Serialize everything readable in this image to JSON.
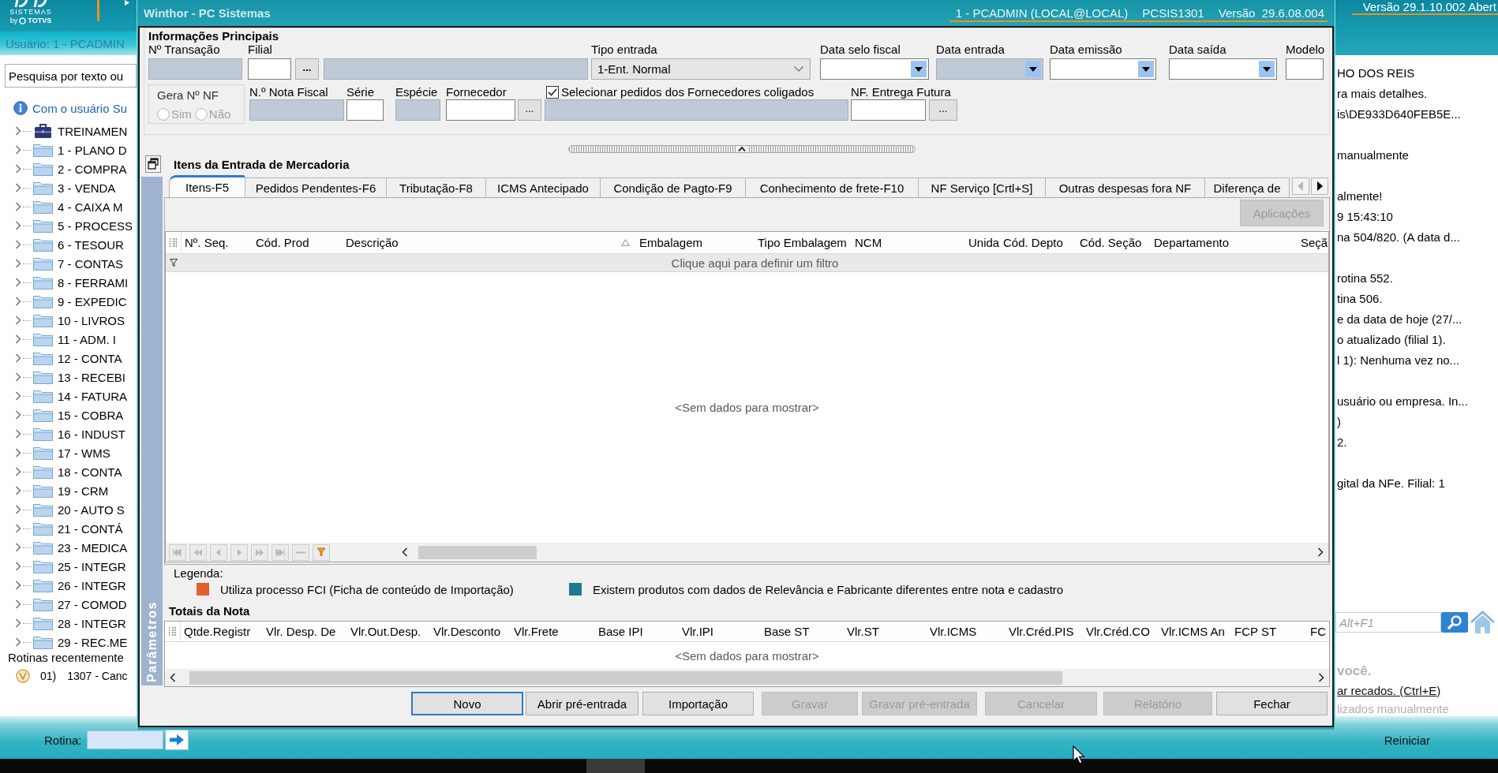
{
  "app": {
    "logo": {
      "name": "SISTEMAS",
      "by": "by",
      "brand": "TOTVS"
    },
    "version": "Versão 29.1.10.002 Abert",
    "user": "Usuário: 1 - PCADMIN",
    "search": {
      "placeholder": "Pesquisa por texto ou"
    },
    "notice": "Com o usuário Su",
    "menu": [
      {
        "label": "TREINAMEN",
        "kind": "briefcase",
        "expanded": false
      },
      {
        "label": "1 - PLANO D",
        "kind": "folder",
        "expanded": false
      },
      {
        "label": "2 - COMPRA",
        "kind": "folder",
        "expanded": false
      },
      {
        "label": "3 - VENDA",
        "kind": "folder",
        "expanded": false
      },
      {
        "label": "4 - CAIXA M",
        "kind": "folder",
        "expanded": false
      },
      {
        "label": "5 - PROCESS",
        "kind": "folder",
        "expanded": false
      },
      {
        "label": "6 - TESOUR",
        "kind": "folder",
        "expanded": false
      },
      {
        "label": "7 - CONTAS",
        "kind": "folder",
        "expanded": false
      },
      {
        "label": "8 - FERRAMI",
        "kind": "folder",
        "expanded": false
      },
      {
        "label": "9 - EXPEDIC",
        "kind": "folder",
        "expanded": false
      },
      {
        "label": "10 - LIVROS",
        "kind": "folder",
        "expanded": false
      },
      {
        "label": "11 - ADM. I",
        "kind": "folder",
        "expanded": false
      },
      {
        "label": "12 - CONTA",
        "kind": "folder",
        "expanded": false
      },
      {
        "label": "13 - RECEBI",
        "kind": "folder",
        "expanded": false
      },
      {
        "label": "14 - FATURA",
        "kind": "folder",
        "expanded": false
      },
      {
        "label": "15 - COBRA",
        "kind": "folder",
        "expanded": false
      },
      {
        "label": "16 - INDUST",
        "kind": "folder",
        "expanded": false
      },
      {
        "label": "17 - WMS",
        "kind": "folder",
        "expanded": false
      },
      {
        "label": "18 - CONTA",
        "kind": "folder",
        "expanded": false
      },
      {
        "label": "19 - CRM",
        "kind": "folder",
        "expanded": false
      },
      {
        "label": "20 - AUTO S",
        "kind": "folder",
        "expanded": false
      },
      {
        "label": "21 - CONTÁ",
        "kind": "folder",
        "expanded": false
      },
      {
        "label": "23 - MEDICA",
        "kind": "folder",
        "expanded": false
      },
      {
        "label": "25 - INTEGR",
        "kind": "folder",
        "expanded": false
      },
      {
        "label": "26 - INTEGR",
        "kind": "folder",
        "expanded": false
      },
      {
        "label": "27 - COMOD",
        "kind": "folder",
        "expanded": false
      },
      {
        "label": "28 - INTEGR",
        "kind": "folder",
        "expanded": false
      },
      {
        "label": "29 - REC.ME",
        "kind": "folder",
        "expanded": false
      }
    ],
    "recent": {
      "title": "Rotinas recentemente",
      "items": [
        {
          "number": "01)",
          "label": "1307 - Canc"
        }
      ]
    },
    "messages": [
      [
        "HO DOS REIS",
        "ra mais detalhes.",
        "is\\DE933D640FEB5E..."
      ],
      [
        "manualmente"
      ],
      [
        "almente!",
        "9 15:43:10",
        "na 504/820. (A data d..."
      ],
      [
        "rotina 552.",
        "tina 506.",
        "e da data de hoje (27/...",
        "o atualizado (filial 1).",
        "l 1): Nenhuma vez no..."
      ],
      [
        "usuário ou empresa. In...",
        ")",
        "2."
      ],
      [
        "gital da NFe. Filial: 1"
      ]
    ],
    "help_search": {
      "placeholder": "Alt+F1"
    },
    "greeting": "você.",
    "link": "ar recados. (Ctrl+E)",
    "footnote": "lizados manualmente",
    "routine": {
      "label": "Rotina:"
    },
    "restart": "Reiniciar"
  },
  "window": {
    "title": "Winthor - PC Sistemas",
    "session": [
      "1 - PCADMIN (LOCAL@LOCAL)",
      "PCSIS1301",
      "Versão  29.6.08.004"
    ]
  },
  "main_info": {
    "title": "Informações Principais",
    "transaction": {
      "label": "Nº Transação",
      "disabled": true
    },
    "branch": {
      "label": "Filial",
      "disabled": false,
      "button": "...",
      "name_disabled": true
    },
    "entry_type": {
      "label": "Tipo entrada",
      "value": "1-Ent. Normal"
    },
    "dates": [
      {
        "label": "Data selo fiscal",
        "disabled": false
      },
      {
        "label": "Data entrada",
        "disabled": true
      },
      {
        "label": "Data emissão",
        "disabled": false
      },
      {
        "label": "Data saída",
        "disabled": false
      }
    ],
    "model": {
      "label": "Modelo",
      "disabled": false
    },
    "generate_nf": {
      "title": "Gera Nº NF",
      "disabled": true,
      "options": [
        {
          "label": "Sim",
          "selected": false
        },
        {
          "label": "Não",
          "selected": false
        }
      ]
    },
    "invoice_number": {
      "label": "N.º Nota Fiscal",
      "disabled": true
    },
    "series": {
      "label": "Série",
      "disabled": false
    },
    "species": {
      "label": "Espécie",
      "disabled": true
    },
    "supplier": {
      "label": "Fornecedor",
      "disabled": false,
      "button": "..."
    },
    "linked_suppliers": {
      "label": "Selecionar pedidos dos Fornecedores coligados",
      "checked": true,
      "name_disabled": true
    },
    "future_delivery": {
      "label": "NF. Entrega Futura",
      "disabled": false,
      "button": "..."
    }
  },
  "side_tab": "Parâmetros",
  "items": {
    "title": "Itens da Entrada de Mercadoria",
    "tabs": [
      {
        "label": "Itens-F5",
        "selected": true
      },
      {
        "label": "Pedidos Pendentes-F6",
        "selected": false
      },
      {
        "label": "Tributação-F8",
        "selected": false
      },
      {
        "label": "ICMS Antecipado",
        "selected": false
      },
      {
        "label": "Condição de Pagto-F9",
        "selected": false
      },
      {
        "label": "Conhecimento de frete-F10",
        "selected": false
      },
      {
        "label": "NF Serviço [Crtl+S]",
        "selected": false
      },
      {
        "label": "Outras despesas fora NF",
        "selected": false
      },
      {
        "label": "Diferença de",
        "selected": false
      }
    ],
    "apply": {
      "label": "Aplicações",
      "disabled": true
    },
    "columns": [
      {
        "label": "Nº. Seq.",
        "sorted": false
      },
      {
        "label": "Cód. Prod",
        "sorted": false
      },
      {
        "label": "Descrição",
        "sorted": true
      },
      {
        "label": "Embalagem",
        "sorted": false
      },
      {
        "label": "Tipo Embalagem",
        "sorted": false
      },
      {
        "label": "NCM",
        "sorted": false
      },
      {
        "label": "Unida",
        "sorted": false
      },
      {
        "label": "Cód. Depto",
        "sorted": false
      },
      {
        "label": "Cód. Seção",
        "sorted": false
      },
      {
        "label": "Departamento",
        "sorted": false
      },
      {
        "label": "Seçã",
        "sorted": false
      }
    ],
    "filter_hint": "Clique aqui para definir um filtro",
    "empty": "<Sem dados para mostrar>"
  },
  "legend": {
    "title": "Legenda:",
    "items": [
      {
        "label": "Utiliza processo FCI (Ficha de conteúdo de Importação)",
        "color": "#e0612c"
      },
      {
        "label": "Existem produtos com dados de Relevância e Fabricante diferentes entre nota e cadastro",
        "color": "#1d7a90"
      }
    ]
  },
  "totals": {
    "title": "Totais da Nota",
    "columns": [
      "Qtde.Registr",
      "Vlr. Desp. De",
      "Vlr.Out.Desp.",
      "Vlr.Desconto",
      "Vlr.Frete",
      "Base IPI",
      "Vlr.IPI",
      "Base ST",
      "Vlr.ST",
      "Vlr.ICMS",
      "Vlr.Créd.PIS",
      "Vlr.Créd.CO",
      "Vlr.ICMS An",
      "FCP ST",
      "FC"
    ],
    "empty": "<Sem dados para mostrar>"
  },
  "buttons": [
    {
      "label": "Novo",
      "disabled": false,
      "focused": true
    },
    {
      "label": "Abrir pré-entrada",
      "disabled": false,
      "focused": false
    },
    {
      "label": "Importação",
      "disabled": false,
      "focused": false
    },
    {
      "label": "Gravar",
      "disabled": true,
      "focused": false
    },
    {
      "label": "Gravar pré-entrada",
      "disabled": true,
      "focused": false
    },
    {
      "label": "Cancelar",
      "disabled": true,
      "focused": false
    },
    {
      "label": "Relatório",
      "disabled": true,
      "focused": false
    },
    {
      "label": "Fechar",
      "disabled": false,
      "focused": false
    }
  ]
}
